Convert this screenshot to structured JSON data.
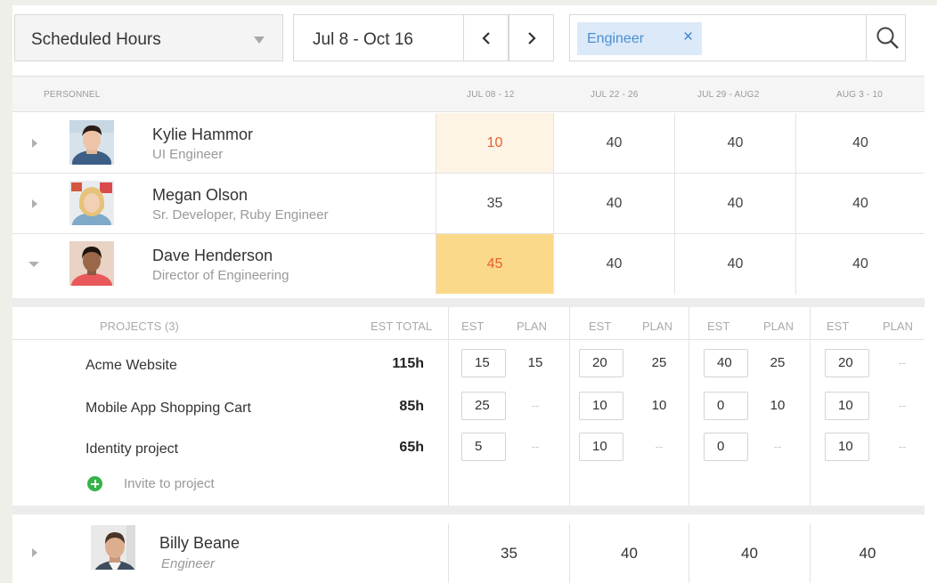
{
  "toolbar": {
    "view_select": "Scheduled Hours",
    "date_range": "Jul 8 - Oct 16",
    "filter_tag": "Engineer",
    "filter_remove": "×"
  },
  "table": {
    "columns": {
      "personnel": "PERSONNEL",
      "weeks": [
        "JUL 08 - 12",
        "JUL 22 - 26",
        "JUL 29 - AUG2",
        "AUG 3 - 10"
      ]
    },
    "people": [
      {
        "name": "Kylie Hammor",
        "role": "UI Engineer",
        "hours": [
          "10",
          "40",
          "40",
          "40"
        ]
      },
      {
        "name": "Megan Olson",
        "role": "Sr. Developer, Ruby Engineer",
        "hours": [
          "35",
          "40",
          "40",
          "40"
        ]
      },
      {
        "name": "Dave Henderson",
        "role": "Director of Engineering",
        "hours": [
          "45",
          "40",
          "40",
          "40"
        ]
      },
      {
        "name": "Billy Beane",
        "role": "Engineer",
        "hours": [
          "35",
          "40",
          "40",
          "40"
        ]
      }
    ]
  },
  "projects": {
    "header": "PROJECTS (3)",
    "est_total_label": "EST TOTAL",
    "est_label": "EST",
    "plan_label": "PLAN",
    "rows": [
      {
        "name": "Acme Website",
        "total": "115h",
        "est": [
          "15",
          "20",
          "40",
          "20"
        ],
        "plan": [
          "15",
          "25",
          "25",
          "--"
        ]
      },
      {
        "name": "Mobile App Shopping Cart",
        "total": "85h",
        "est": [
          "25",
          "10",
          "0",
          "10"
        ],
        "plan": [
          "--",
          "10",
          "10",
          "--"
        ]
      },
      {
        "name": "Identity project",
        "total": "65h",
        "est": [
          "5",
          "10",
          "0",
          "10"
        ],
        "plan": [
          "--",
          "--",
          "--",
          "--"
        ]
      }
    ],
    "invite_label": "Invite to project"
  }
}
